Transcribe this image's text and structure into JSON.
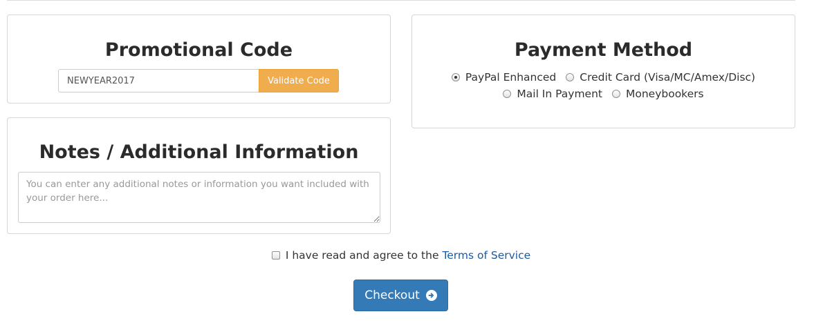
{
  "promo": {
    "title": "Promotional Code",
    "code_value": "NEWYEAR2017",
    "validate_label": "Validate Code"
  },
  "notes": {
    "title": "Notes / Additional Information",
    "placeholder": "You can enter any additional notes or information you want included with your order here..."
  },
  "payment": {
    "title": "Payment Method",
    "options": [
      {
        "label": "PayPal Enhanced",
        "selected": true
      },
      {
        "label": "Credit Card (Visa/MC/Amex/Disc)",
        "selected": false
      },
      {
        "label": "Mail In Payment",
        "selected": false
      },
      {
        "label": "Moneybookers",
        "selected": false
      }
    ]
  },
  "terms": {
    "text": "I have read and agree to the",
    "link_text": "Terms of Service",
    "checked": false
  },
  "checkout": {
    "label": "Checkout",
    "icon": "arrow-circle-right-icon"
  },
  "colors": {
    "accent_blue": "#337ab7",
    "validate_orange": "#f0ad4e",
    "link_blue": "#1a5aa0"
  }
}
